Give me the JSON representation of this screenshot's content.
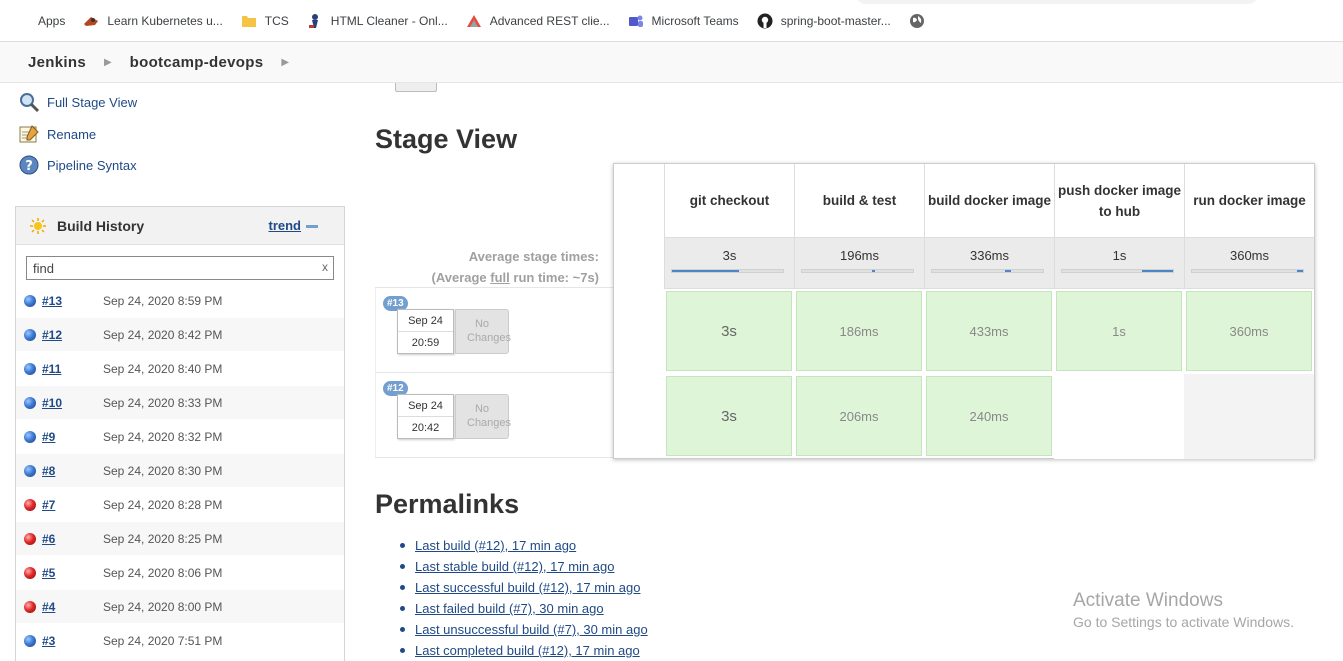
{
  "bookmarks": [
    {
      "label": "Apps",
      "icon": "apps-grid-icon"
    },
    {
      "label": "Learn Kubernetes u...",
      "icon": "kubernetes-icon"
    },
    {
      "label": "TCS",
      "icon": "folder-icon"
    },
    {
      "label": "HTML Cleaner - Onl...",
      "icon": "html-cleaner-icon"
    },
    {
      "label": "Advanced REST clie...",
      "icon": "rest-client-icon"
    },
    {
      "label": "Microsoft Teams",
      "icon": "teams-icon"
    },
    {
      "label": "spring-boot-master...",
      "icon": "github-icon"
    }
  ],
  "breadcrumb": {
    "root": "Jenkins",
    "job": "bootcamp-devops"
  },
  "sidebar": {
    "tasks": [
      {
        "label": "Full Stage View",
        "icon": "magnifier-icon"
      },
      {
        "label": "Rename",
        "icon": "notepad-icon"
      },
      {
        "label": "Pipeline Syntax",
        "icon": "help-icon"
      }
    ],
    "build_history": {
      "title": "Build History",
      "trend": "trend",
      "search_value": "find",
      "clear": "x",
      "builds": [
        {
          "num": "#13",
          "date": "Sep 24, 2020 8:59 PM",
          "status": "blue"
        },
        {
          "num": "#12",
          "date": "Sep 24, 2020 8:42 PM",
          "status": "blue"
        },
        {
          "num": "#11",
          "date": "Sep 24, 2020 8:40 PM",
          "status": "blue"
        },
        {
          "num": "#10",
          "date": "Sep 24, 2020 8:33 PM",
          "status": "blue"
        },
        {
          "num": "#9",
          "date": "Sep 24, 2020 8:32 PM",
          "status": "blue"
        },
        {
          "num": "#8",
          "date": "Sep 24, 2020 8:30 PM",
          "status": "blue"
        },
        {
          "num": "#7",
          "date": "Sep 24, 2020 8:28 PM",
          "status": "red"
        },
        {
          "num": "#6",
          "date": "Sep 24, 2020 8:25 PM",
          "status": "red"
        },
        {
          "num": "#5",
          "date": "Sep 24, 2020 8:06 PM",
          "status": "red"
        },
        {
          "num": "#4",
          "date": "Sep 24, 2020 8:00 PM",
          "status": "red"
        },
        {
          "num": "#3",
          "date": "Sep 24, 2020 7:51 PM",
          "status": "blue"
        }
      ]
    }
  },
  "stage_view": {
    "title": "Stage View",
    "avg_label_1": "Average stage times:",
    "avg_label_2_prefix": "(Average ",
    "avg_label_2_link": "full",
    "avg_label_2_suffix": " run time: ~7s)",
    "stages": [
      {
        "name": "git checkout",
        "avg": "3s",
        "avg_fraction": 0.6
      },
      {
        "name": "build & test",
        "avg": "196ms",
        "avg_fraction": 0.03
      },
      {
        "name": "build docker image",
        "avg": "336ms",
        "avg_fraction": 0.05
      },
      {
        "name": "push docker image to hub",
        "avg": "1s",
        "avg_fraction": 0.28
      },
      {
        "name": "run docker image",
        "avg": "360ms",
        "avg_fraction": 0.05
      }
    ],
    "runs": [
      {
        "badge": "#13",
        "date": "Sep 24",
        "time": "20:59",
        "changes": "No Changes",
        "cells": [
          "3s",
          "186ms",
          "433ms",
          "1s",
          "360ms"
        ]
      },
      {
        "badge": "#12",
        "date": "Sep 24",
        "time": "20:42",
        "changes": "No Changes",
        "cells": [
          "3s",
          "206ms",
          "240ms",
          "",
          ""
        ]
      }
    ]
  },
  "permalinks": {
    "title": "Permalinks",
    "items": [
      "Last build (#12), 17 min ago",
      "Last stable build (#12), 17 min ago",
      "Last successful build (#12), 17 min ago",
      "Last failed build (#7), 30 min ago",
      "Last unsuccessful build (#7), 30 min ago",
      "Last completed build (#12), 17 min ago"
    ]
  },
  "watermark": {
    "line1": "Activate Windows",
    "line2": "Go to Settings to activate Windows."
  }
}
